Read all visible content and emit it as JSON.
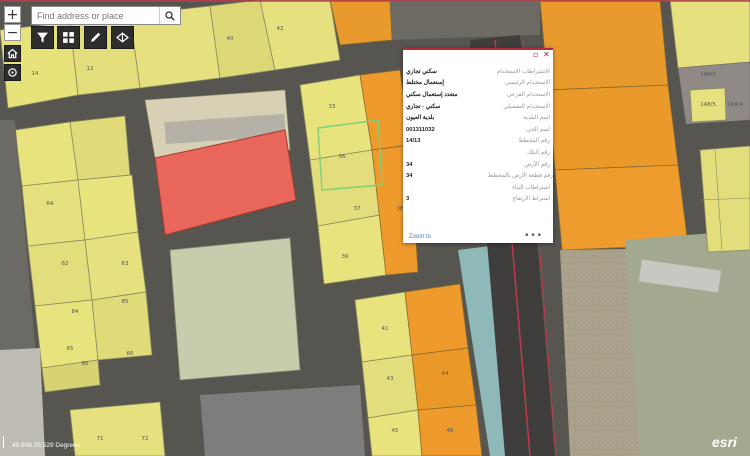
{
  "search": {
    "placeholder": "Find address or place"
  },
  "controls": {
    "zoom_in": "+",
    "zoom_out": "−"
  },
  "popup": {
    "rows": [
      {
        "label": "الاشتراطات الاستخدام",
        "value": "سكني تجاري"
      },
      {
        "label": "الاستخدام الرئيسي",
        "value": "إستعمال مختلط"
      },
      {
        "label": "الاستخدام الفرعي",
        "value": "متعدد إستعمال سكني"
      },
      {
        "label": "الاستخدام التفصيلي",
        "value": "سكني - تجاري"
      },
      {
        "label": "اسم البلدية",
        "value": "بلدية العيون"
      },
      {
        "label": "اسم الحي",
        "value": "001311032"
      },
      {
        "label": "رقم المخطط",
        "value": "14/13"
      },
      {
        "label": "رقم البلك",
        "value": ""
      },
      {
        "label": "رقم الأرض",
        "value": "34"
      },
      {
        "label": "رقم قطعة الأرض بالمخطط",
        "value": "34"
      },
      {
        "label": "اشتراطات البناء",
        "value": ""
      },
      {
        "label": "اشتراط الارتفاع",
        "value": "3"
      }
    ],
    "zoom_to": "Zoom to",
    "more": "•••"
  },
  "map": {
    "coordinates": "49.608 25.529 Degrees",
    "attribution": "esri",
    "parcel_numbers": {
      "top_left": [
        "14",
        "12",
        "40",
        "42"
      ],
      "left_block": [
        "64",
        "62",
        "63",
        "84",
        "85",
        "86",
        "66",
        "65"
      ],
      "center_block": [
        "33",
        "39",
        "37",
        "36",
        "38"
      ],
      "lower_center": [
        "41",
        "43",
        "44",
        "45",
        "46"
      ],
      "bottom": [
        "71",
        "72"
      ],
      "right_block": [
        "148/3",
        "148/5",
        "148/4"
      ]
    }
  }
}
